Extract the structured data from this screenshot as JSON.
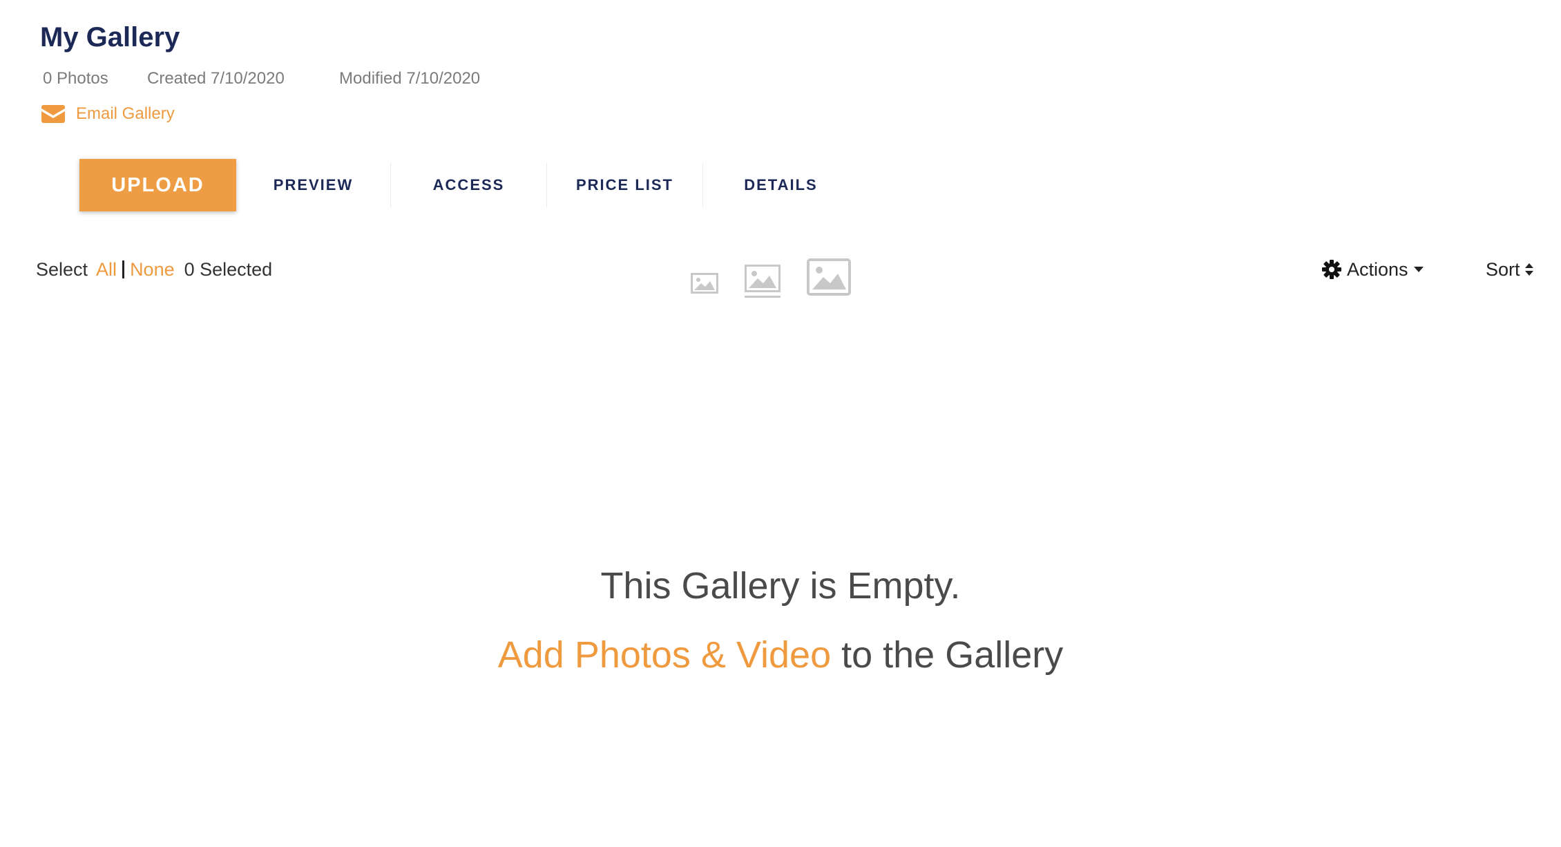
{
  "gallery": {
    "title": "My Gallery",
    "photos_count": "0 Photos",
    "created": "Created 7/10/2020",
    "modified": "Modified 7/10/2020",
    "email_label": "Email Gallery"
  },
  "tabs": {
    "upload": "UPLOAD",
    "preview": "PREVIEW",
    "access": "ACCESS",
    "price_list": "PRICE LIST",
    "details": "DETAILS"
  },
  "toolbar": {
    "select_label": "Select",
    "all_label": "All",
    "none_label": "None",
    "selected_count": "0 Selected",
    "view_icons": [
      "small-thumbnail-view-icon",
      "medium-thumbnail-view-icon",
      "large-thumbnail-view-icon"
    ],
    "actions_label": "Actions",
    "sort_label": "Sort"
  },
  "empty_state": {
    "title": "This Gallery is Empty.",
    "link_text": "Add Photos & Video",
    "suffix": " to the Gallery"
  },
  "colors": {
    "accent": "#ef9d44",
    "title_navy": "#1c2957",
    "meta_gray": "#7b7b7b",
    "icon_gray": "#c8c8c8"
  }
}
